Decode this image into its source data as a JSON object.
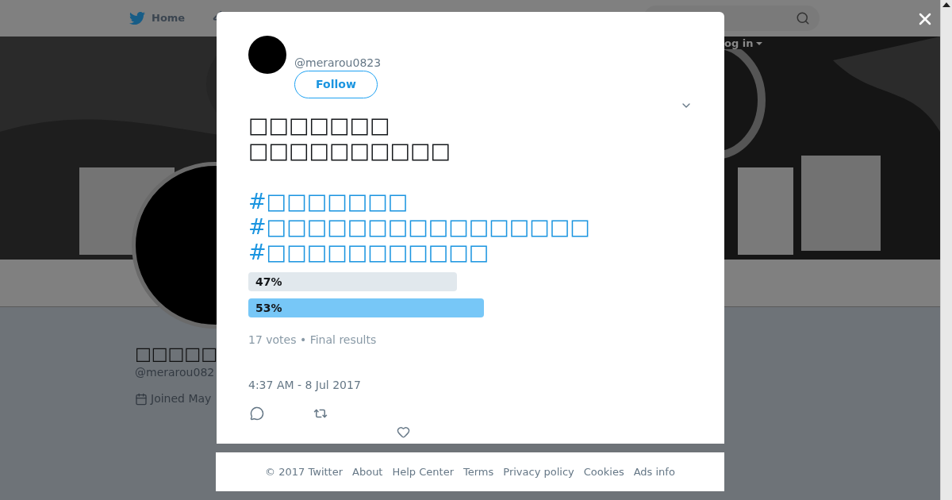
{
  "header": {
    "home": "Home",
    "login": "og in"
  },
  "profile": {
    "name": "□□□□□",
    "handle": "@merarou082",
    "joined": "Joined May"
  },
  "tweet": {
    "handle": "@merarou0823",
    "follow": "Follow",
    "text_lines": [
      "□□□□□□□",
      "□□□□□□□□□□"
    ],
    "hashtags": [
      "#□□□□□□□",
      "#□□□□□□□□□□□□□□□□",
      "#□□□□□□□□□□□"
    ],
    "poll": [
      {
        "label": "47%",
        "winner": false
      },
      {
        "label": "53%",
        "winner": true
      }
    ],
    "summary": "17 votes • Final results",
    "timestamp": "4:37 AM - 8 Jul 2017"
  },
  "footer": [
    "© 2017 Twitter",
    "About",
    "Help Center",
    "Terms",
    "Privacy policy",
    "Cookies",
    "Ads info"
  ]
}
